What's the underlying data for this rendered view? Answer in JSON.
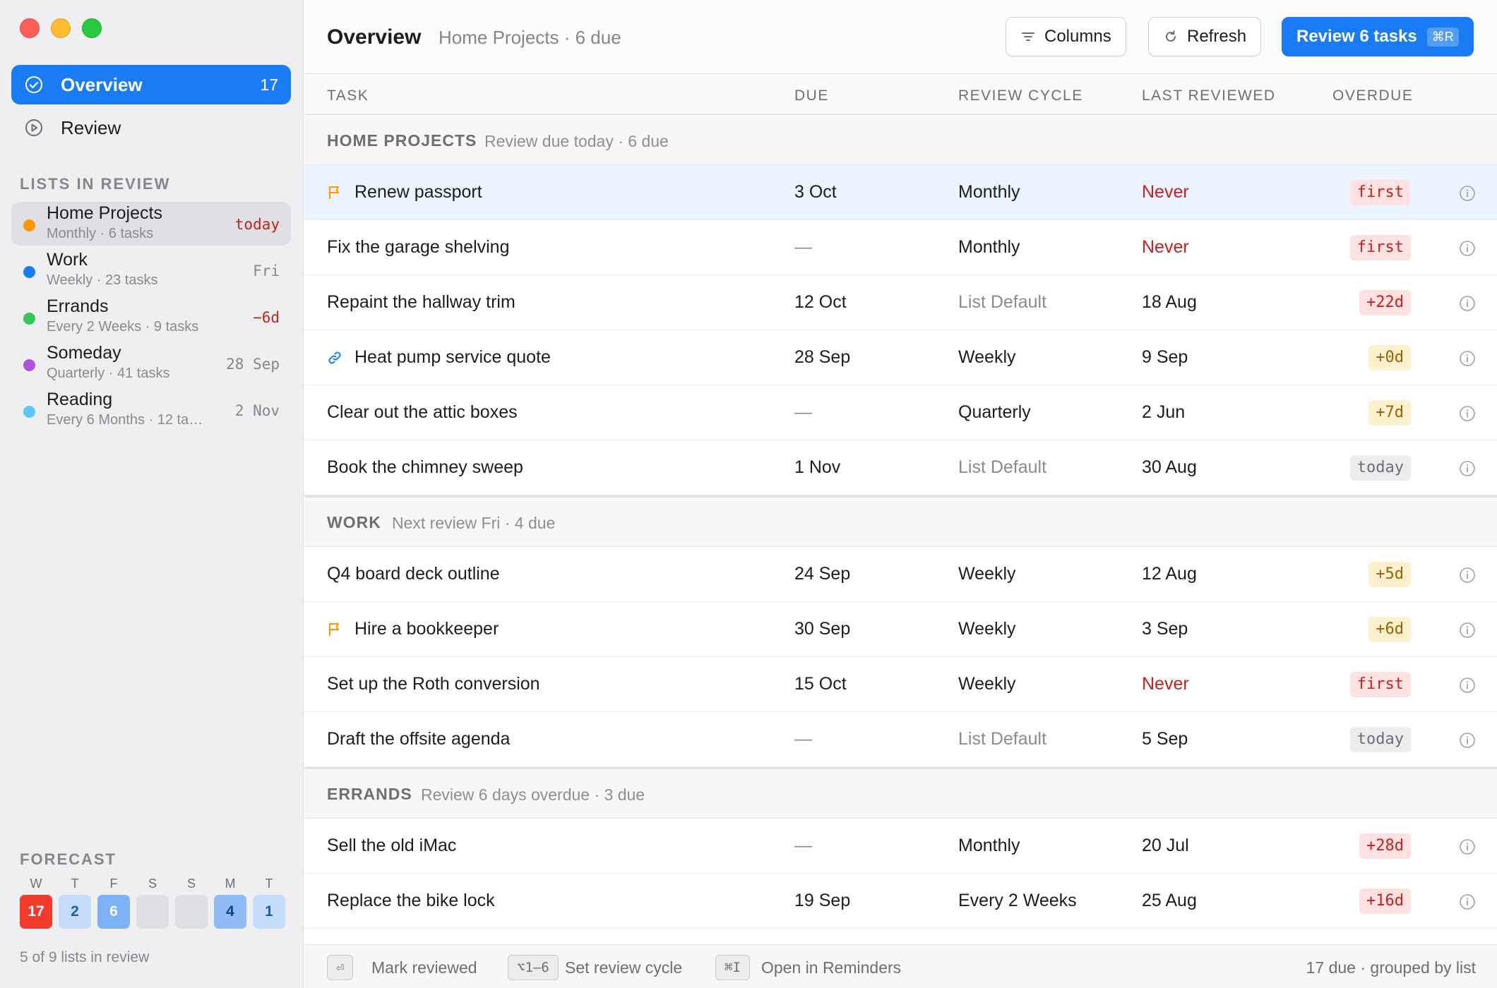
{
  "sidebar": {
    "nav": [
      {
        "label": "Overview",
        "count": "17",
        "icon": "check-circle-icon"
      },
      {
        "label": "Review",
        "count": "",
        "icon": "play-circle-icon"
      }
    ],
    "lists_title": "LISTS IN REVIEW",
    "lists": [
      {
        "name": "Home Projects",
        "sub": "Monthly · 6 tasks",
        "when": "today",
        "color": "#ff9500"
      },
      {
        "name": "Work",
        "sub": "Weekly · 23 tasks",
        "when": "Fri",
        "color": "#1a7cf5"
      },
      {
        "name": "Errands",
        "sub": "Every 2 Weeks · 9 tasks",
        "when": "−6d",
        "color": "#34c759"
      },
      {
        "name": "Someday",
        "sub": "Quarterly · 41 tasks",
        "when": "28 Sep",
        "color": "#af52de"
      },
      {
        "name": "Reading",
        "sub": "Every 6 Months · 12 ta…",
        "when": "2 Nov",
        "color": "#5ac8fa"
      }
    ],
    "forecast_title": "FORECAST",
    "forecast": [
      {
        "day": "W",
        "count": "17"
      },
      {
        "day": "T",
        "count": "2"
      },
      {
        "day": "F",
        "count": "6"
      },
      {
        "day": "S",
        "count": ""
      },
      {
        "day": "S",
        "count": ""
      },
      {
        "day": "M",
        "count": "4"
      },
      {
        "day": "T",
        "count": "1"
      }
    ],
    "footer": "5 of 9 lists in review"
  },
  "toolbar": {
    "title": "Overview",
    "subtitle": "Home Projects · 6 due",
    "columns_label": "Columns",
    "refresh_label": "Refresh",
    "review_label": "Review 6 tasks",
    "review_shortcut": "⌘R"
  },
  "columns": {
    "task": "TASK",
    "due": "DUE",
    "cycle": "REVIEW CYCLE",
    "last": "LAST REVIEWED",
    "overdue": "OVERDUE"
  },
  "groups": [
    {
      "name": "HOME PROJECTS",
      "sub": "Review due today · 6 due",
      "rows": [
        {
          "task": "Renew passport",
          "icon": "flag-icon",
          "due": "3 Oct",
          "cycle": "Monthly",
          "last": "Never",
          "overdue": "first"
        },
        {
          "task": "Fix the garage shelving",
          "icon": "",
          "due": "—",
          "cycle": "Monthly",
          "last": "Never",
          "overdue": "first"
        },
        {
          "task": "Repaint the hallway trim",
          "icon": "",
          "due": "12 Oct",
          "cycle": "List Default",
          "last": "18 Aug",
          "overdue": "+22d"
        },
        {
          "task": "Heat pump service quote",
          "icon": "link-icon",
          "due": "28 Sep",
          "cycle": "Weekly",
          "last": "9 Sep",
          "overdue": "+0d"
        },
        {
          "task": "Clear out the attic boxes",
          "icon": "",
          "due": "—",
          "cycle": "Quarterly",
          "last": "2 Jun",
          "overdue": "+7d"
        },
        {
          "task": "Book the chimney sweep",
          "icon": "",
          "due": "1 Nov",
          "cycle": "List Default",
          "last": "30 Aug",
          "overdue": "today"
        }
      ]
    },
    {
      "name": "WORK",
      "sub": "Next review Fri · 4 due",
      "rows": [
        {
          "task": "Q4 board deck outline",
          "icon": "",
          "due": "24 Sep",
          "cycle": "Weekly",
          "last": "12 Aug",
          "overdue": "+5d"
        },
        {
          "task": "Hire a bookkeeper",
          "icon": "flag-icon",
          "due": "30 Sep",
          "cycle": "Weekly",
          "last": "3 Sep",
          "overdue": "+6d"
        },
        {
          "task": "Set up the Roth conversion",
          "icon": "",
          "due": "15 Oct",
          "cycle": "Weekly",
          "last": "Never",
          "overdue": "first"
        },
        {
          "task": "Draft the offsite agenda",
          "icon": "",
          "due": "—",
          "cycle": "List Default",
          "last": "5 Sep",
          "overdue": "today"
        }
      ]
    },
    {
      "name": "ERRANDS",
      "sub": "Review 6 days overdue · 3 due",
      "rows": [
        {
          "task": "Sell the old iMac",
          "icon": "",
          "due": "—",
          "cycle": "Monthly",
          "last": "20 Jul",
          "overdue": "+28d"
        },
        {
          "task": "Replace the bike lock",
          "icon": "",
          "due": "19 Sep",
          "cycle": "Every 2 Weeks",
          "last": "25 Aug",
          "overdue": "+16d"
        }
      ]
    }
  ],
  "footer": {
    "hints": [
      {
        "key": "⏎",
        "label": "Mark reviewed"
      },
      {
        "key": "⌥1–6",
        "label": "Set review cycle"
      },
      {
        "key": "⌘I",
        "label": "Open in Reminders"
      }
    ],
    "summary": "17 due · grouped by list"
  },
  "colors": {
    "accent": "#1a7cf5",
    "flag": "#ff9500",
    "danger": "#c5221f",
    "warning": "#9a6200"
  }
}
